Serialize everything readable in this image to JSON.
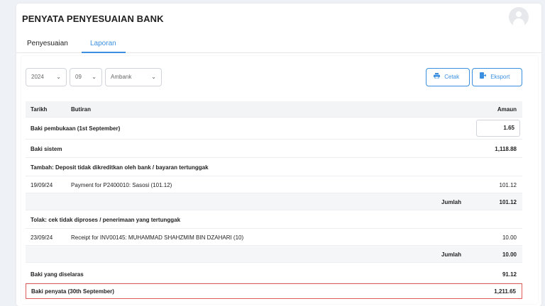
{
  "page": {
    "title": "PENYATA PENYESUAIAN BANK"
  },
  "tabs": [
    {
      "label": "Penyesuaian"
    },
    {
      "label": "Laporan"
    }
  ],
  "filters": {
    "year": "2024",
    "month": "09",
    "bank": "Ambank"
  },
  "actions": {
    "print_label": "Cetak",
    "export_label": "Eksport"
  },
  "table": {
    "headers": {
      "date": "Tarikh",
      "desc": "Butiran",
      "amount": "Amaun"
    },
    "opening": {
      "label": "Baki pembukaan (1st September)",
      "amount": "1.65"
    },
    "system": {
      "label": "Baki sistem",
      "amount": "1,118.88"
    },
    "add_section": {
      "label": "Tambah: Deposit tidak dikreditkan oleh bank / bayaran tertunggak",
      "rows": [
        {
          "date": "19/09/24",
          "desc": "Payment for P2400010: Sasosi (101.12)",
          "amount": "101.12"
        }
      ],
      "total_label": "Jumlah",
      "total": "101.12"
    },
    "less_section": {
      "label": "Tolak: cek tidak diproses / penerimaan yang tertunggak",
      "rows": [
        {
          "date": "23/09/24",
          "desc": "Receipt for INV00145: MUHAMMAD SHAHZMIM BIN DZAHARI (10)",
          "amount": "10.00"
        }
      ],
      "total_label": "Jumlah",
      "total": "10.00"
    },
    "reconciled": {
      "label": "Baki yang diselaras",
      "amount": "91.12"
    },
    "statement": {
      "label": "Baki penyata (30th September)",
      "amount": "1,211.65"
    }
  },
  "icons": {
    "print": "printer-icon",
    "export": "export-icon",
    "avatar": "user-avatar-icon",
    "chevron": "chevron-down-icon"
  },
  "colors": {
    "accent": "#3b8fe0",
    "highlight": "#e15b5b"
  }
}
